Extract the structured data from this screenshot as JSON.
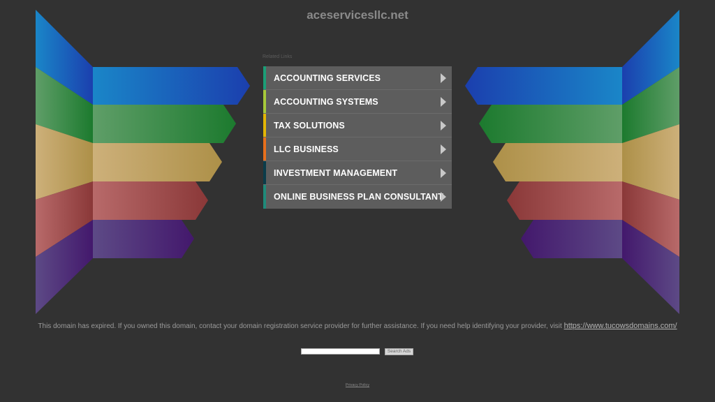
{
  "site": {
    "title": "aceservicesllc.net"
  },
  "related_links_label": "Related Links",
  "links": [
    {
      "label": "ACCOUNTING SERVICES",
      "color": "#1b9e77"
    },
    {
      "label": "ACCOUNTING SYSTEMS",
      "color": "#a6c93a"
    },
    {
      "label": "TAX SOLUTIONS",
      "color": "#e3b505"
    },
    {
      "label": "LLC BUSINESS",
      "color": "#e76f1c"
    },
    {
      "label": "INVESTMENT MANAGEMENT",
      "color": "#0b3c4a"
    },
    {
      "label": "ONLINE BUSINESS PLAN CONSULTANT",
      "color": "#1f8a7a"
    }
  ],
  "expired_notice": {
    "text": "This domain has expired. If you owned this domain, contact your domain registration service provider for further assistance. If you need help identifying your provider, visit",
    "link": "https://www.tucowsdomains.com/"
  },
  "search": {
    "button_label": "Search Ads",
    "placeholder": ""
  },
  "privacy_policy": "Privacy Policy",
  "palette": {
    "blue": [
      "#1a7fc4",
      "#1b46b0"
    ],
    "green": [
      "#5a9a5a",
      "#1e7a30"
    ],
    "tan": [
      "#c9a86a",
      "#b29250"
    ],
    "red": [
      "#b36060",
      "#8a3a3a"
    ],
    "purple": [
      "#5a4080",
      "#45206e"
    ]
  }
}
